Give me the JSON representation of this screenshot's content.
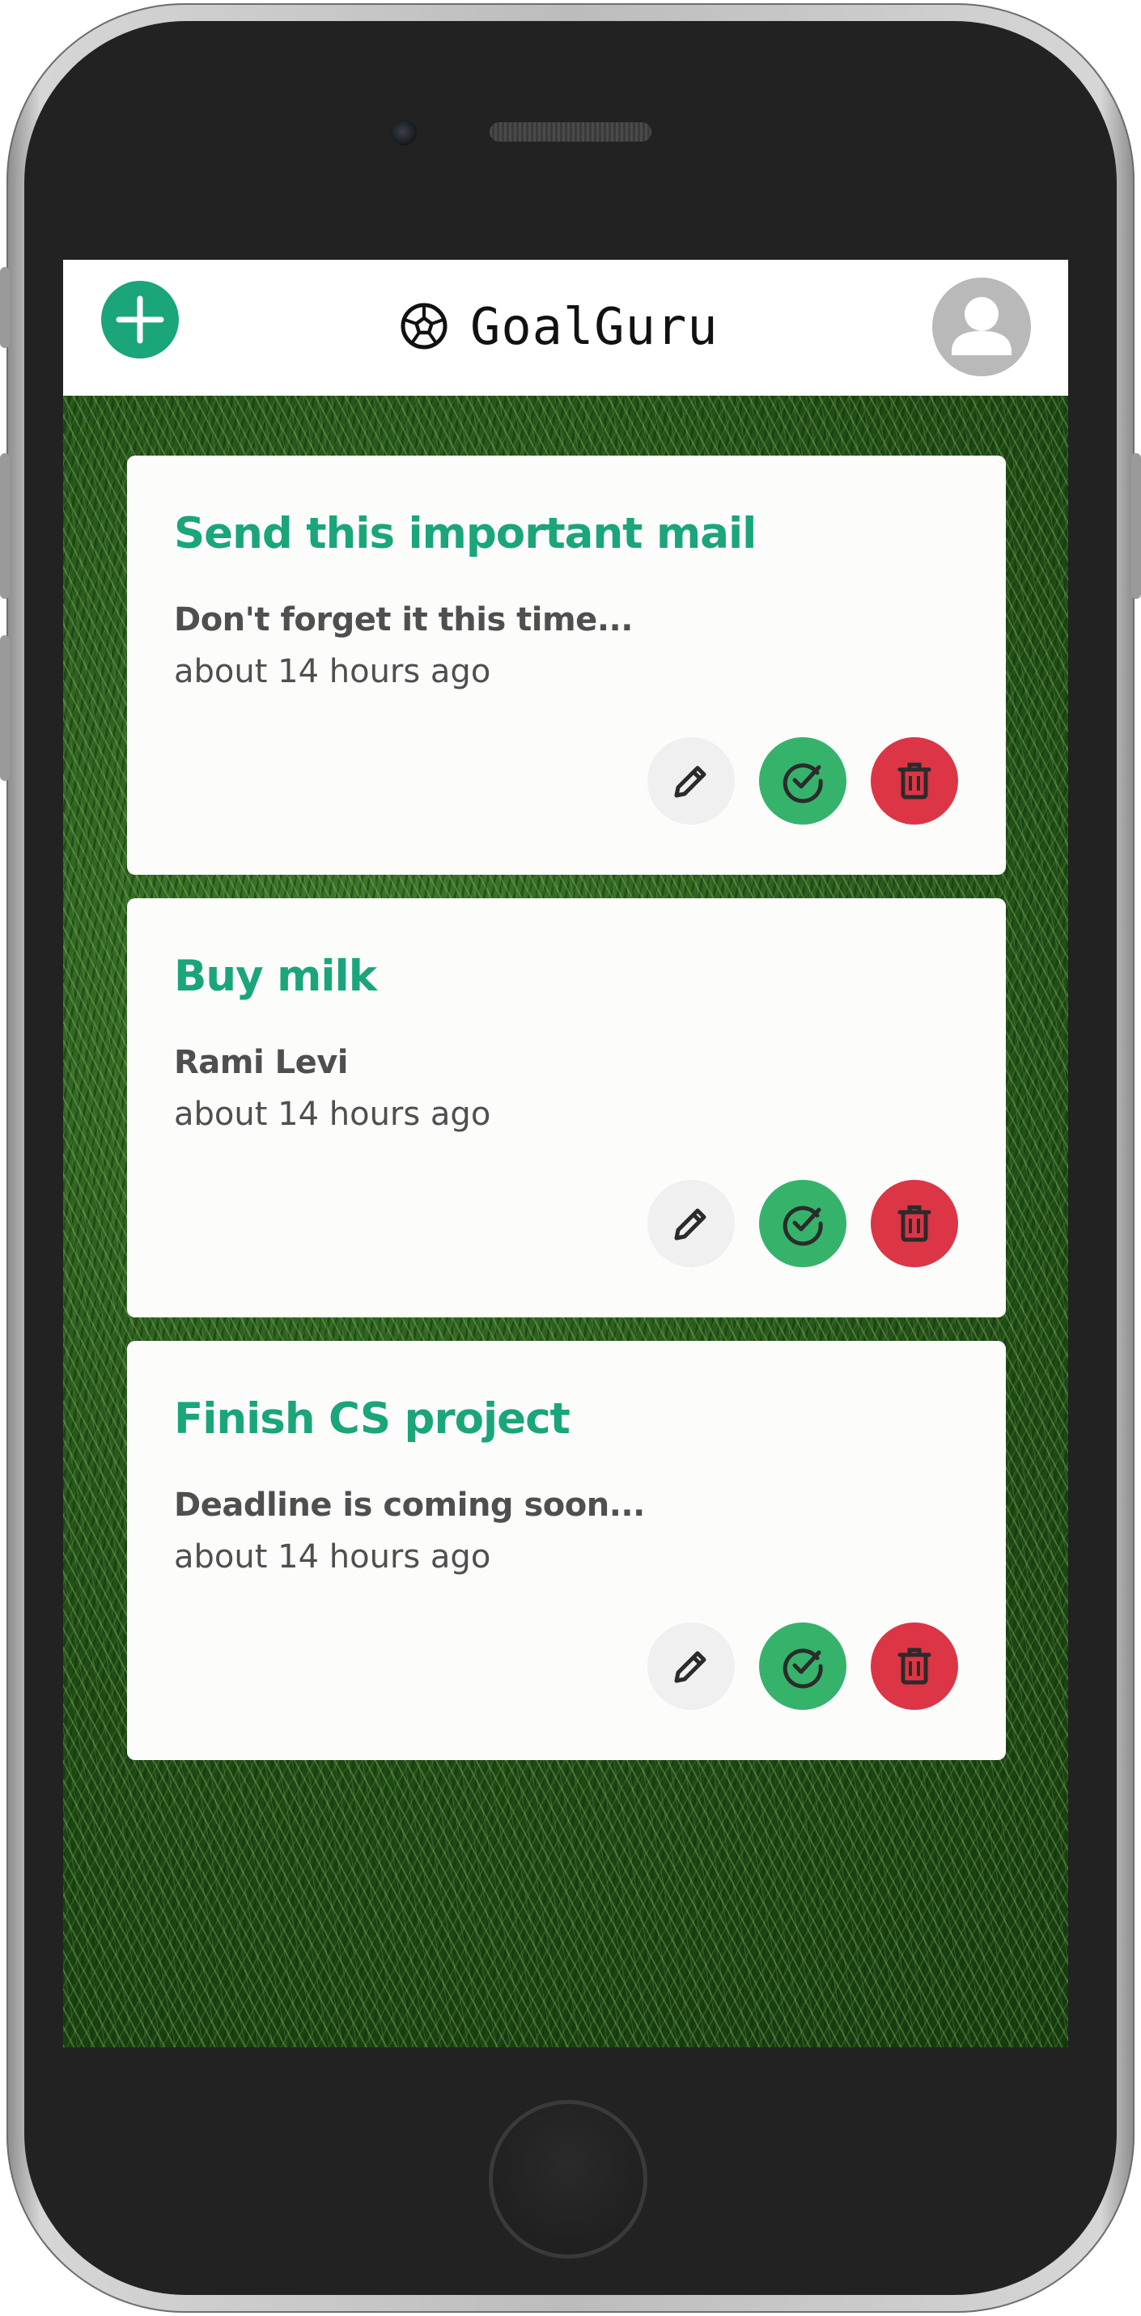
{
  "app": {
    "name": "GoalGuru"
  },
  "header": {
    "add_icon": "plus-icon",
    "logo_icon": "soccer-ball-icon",
    "avatar_icon": "user-icon"
  },
  "colors": {
    "accent": "#1aa57a",
    "complete": "#35b36b",
    "delete": "#dc3545",
    "edit_bg": "#f0f0f0",
    "text": "#4f4f4f"
  },
  "goals": [
    {
      "title": "Send this important mail",
      "description": "Don't forget it this time...",
      "time": "about 14 hours ago"
    },
    {
      "title": "Buy milk",
      "description": "Rami Levi",
      "time": "about 14 hours ago"
    },
    {
      "title": "Finish CS project",
      "description": "Deadline is coming soon...",
      "time": "about 14 hours ago"
    }
  ],
  "card_actions": {
    "edit_icon": "pencil-icon",
    "complete_icon": "check-circle-icon",
    "delete_icon": "trash-icon"
  }
}
